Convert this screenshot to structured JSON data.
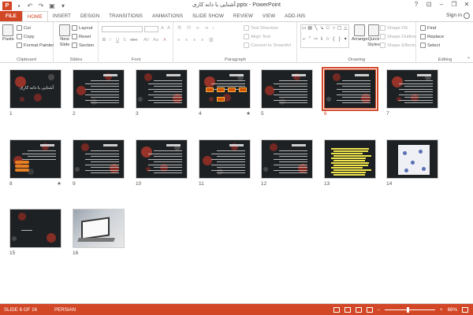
{
  "window": {
    "title": "آشنایی با دانه کاری.pptx - PowerPoint",
    "app_badge": "P"
  },
  "tabs": [
    {
      "label": "FILE"
    },
    {
      "label": "HOME"
    },
    {
      "label": "INSERT"
    },
    {
      "label": "DESIGN"
    },
    {
      "label": "TRANSITIONS"
    },
    {
      "label": "ANIMATIONS"
    },
    {
      "label": "SLIDE SHOW"
    },
    {
      "label": "REVIEW"
    },
    {
      "label": "VIEW"
    },
    {
      "label": "ADD-INS"
    }
  ],
  "signin_label": "Sign in",
  "ribbon": {
    "clipboard": {
      "paste": "Paste",
      "cut": "Cut",
      "copy": "Copy",
      "format_painter": "Format Painter",
      "label": "Clipboard"
    },
    "slides": {
      "new_slide": "New Slide",
      "layout": "Layout",
      "reset": "Reset",
      "section": "Section",
      "label": "Slides"
    },
    "font": {
      "label": "Font"
    },
    "paragraph": {
      "text_direction": "Text Direction",
      "align_text": "Align Text",
      "convert_smartart": "Convert to SmartArt",
      "label": "Paragraph"
    },
    "drawing": {
      "arrange": "Arrange",
      "quick_styles": "Quick Styles",
      "shape_fill": "Shape Fill",
      "shape_outline": "Shape Outline",
      "shape_effects": "Shape Effects",
      "label": "Drawing"
    },
    "editing": {
      "find": "Find",
      "replace": "Replace",
      "select": "Select",
      "label": "Editing"
    }
  },
  "slides": [
    {
      "num": "1",
      "caption": "آشنایی با دانه کاری"
    },
    {
      "num": "2"
    },
    {
      "num": "3"
    },
    {
      "num": "4",
      "transition": "★"
    },
    {
      "num": "5"
    },
    {
      "num": "6",
      "selected": true
    },
    {
      "num": "7"
    },
    {
      "num": "8",
      "transition": "★"
    },
    {
      "num": "9"
    },
    {
      "num": "10"
    },
    {
      "num": "11"
    },
    {
      "num": "12"
    },
    {
      "num": "13"
    },
    {
      "num": "14"
    },
    {
      "num": "15"
    },
    {
      "num": "16"
    }
  ],
  "status": {
    "slide_info": "SLIDE 6 OF 16",
    "language": "PERSIAN",
    "zoom": "68%"
  },
  "colors": {
    "accent": "#d24726",
    "slide_bg": "#1e2124",
    "highlight_yellow": "#f1e64a"
  }
}
